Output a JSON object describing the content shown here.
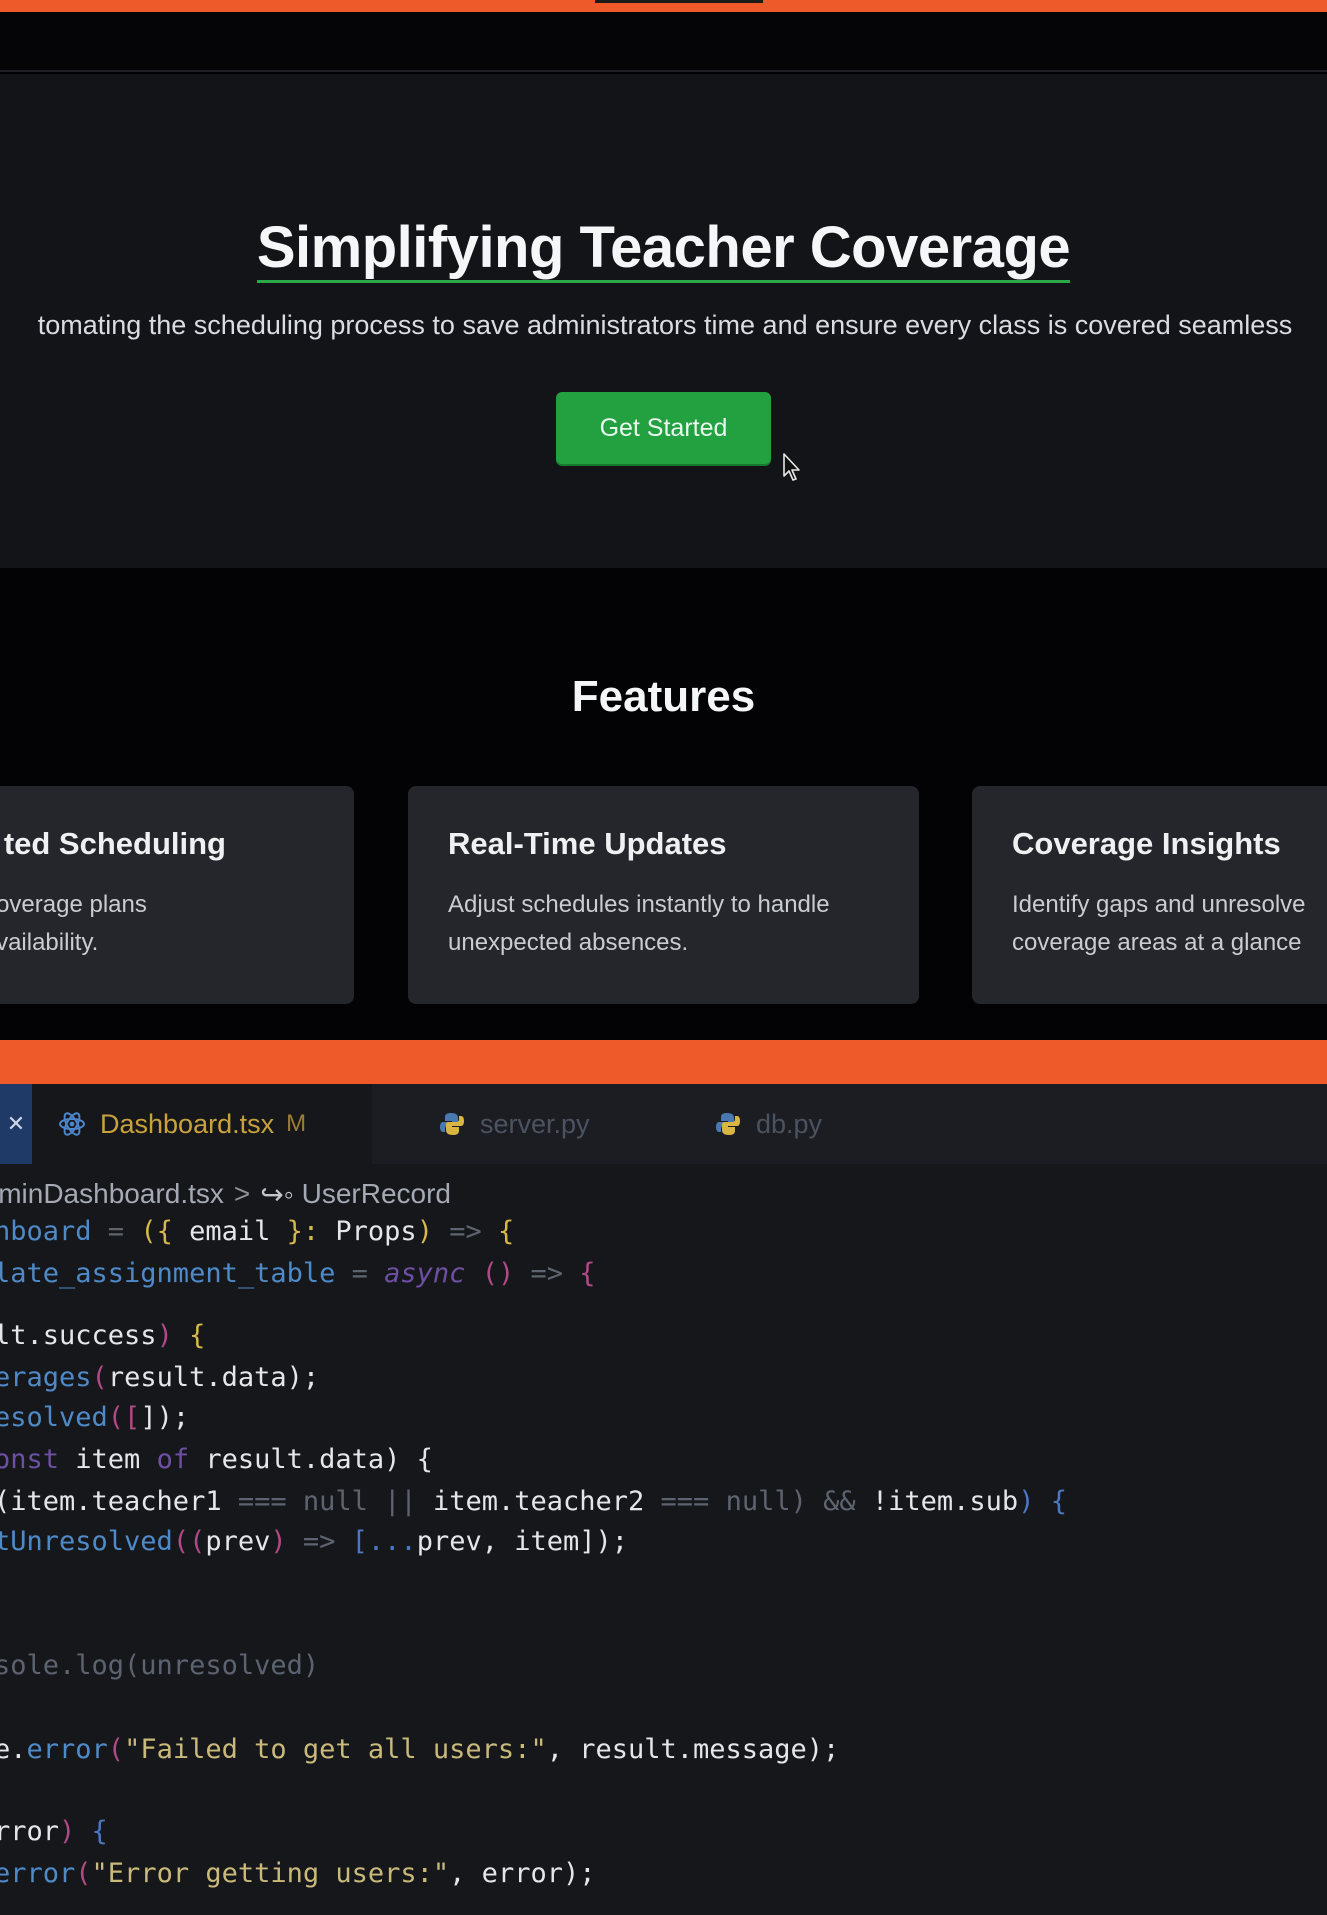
{
  "web": {
    "hero": {
      "title": "Simplifying Teacher Coverage",
      "subtitle": "tomating the scheduling process to save administrators time and ensure every class is covered seamless",
      "cta_label": "Get Started"
    },
    "features": {
      "title": "Features",
      "cards": [
        {
          "title": "ted Scheduling",
          "desc_line1": "enerate coverage plans",
          "desc_line2": "teacher availability."
        },
        {
          "title": "Real-Time Updates",
          "desc_line1": "Adjust schedules instantly to handle",
          "desc_line2": "unexpected absences."
        },
        {
          "title": "Coverage Insights",
          "desc_line1": "Identify gaps and unresolve",
          "desc_line2": "coverage areas at a glance"
        }
      ]
    }
  },
  "editor": {
    "tabs": [
      {
        "label": "Dashboard.tsx",
        "status": "M",
        "icon": "react-icon"
      },
      {
        "label": "server.py",
        "icon": "python-icon"
      },
      {
        "label": "db.py",
        "icon": "python-icon"
      }
    ],
    "close_glyph": "✕",
    "breadcrumb": {
      "file": "lminDashboard.tsx",
      "separator": ">",
      "symbol_icon": "↪◦",
      "symbol": "UserRecord"
    },
    "code_tokens": {
      "l1a": "hboard",
      "l1b": " = ",
      "l1c": "({",
      "l1d": " email ",
      "l1e": "}:",
      "l1f": " Props",
      "l1g": ")",
      "l1h": " => ",
      "l1i": "{",
      "l2a": "late_assignment_table",
      "l2b": " = ",
      "l2c": "async",
      "l2d": " ()",
      "l2e": " => ",
      "l2f": "{",
      "l3a": "lt.success",
      "l3b": ")",
      "l3c": " {",
      "l4a": "erages",
      "l4b": "(",
      "l4c": "result.data",
      "l4d": ");",
      "l5a": "esolved",
      "l5b": "([",
      "l5c": "]);",
      "l6a": "onst",
      "l6b": " item ",
      "l6c": "of",
      "l6d": " result.data",
      "l6e": ") {",
      "l7a": "(item.teacher1 ",
      "l7b": "===",
      "l7c": " null ",
      "l7d": "||",
      "l7e": " item.teacher2 ",
      "l7f": "===",
      "l7g": " null) ",
      "l7h": "&&",
      "l7i": " !item.sub",
      "l7j": ") {",
      "l8a": "tUnresolved",
      "l8b": "((",
      "l8c": "prev",
      "l8d": ")",
      "l8e": " => ",
      "l8f": "[...",
      "l8g": "prev, item",
      "l8h": "]);",
      "l9a": "sole.log(unresolved)",
      "l10a": "e.",
      "l10b": "error",
      "l10c": "(",
      "l10d": "\"Failed to get all users:\"",
      "l10e": ", result.message);",
      "l11a": "rror",
      "l11b": ")",
      "l11c": " {",
      "l12a": "error",
      "l12b": "(",
      "l12c": "\"Error getting users:\"",
      "l12d": ", error);"
    }
  },
  "colors": {
    "accent_orange": "#ef5a2b",
    "cta_green": "#23a040",
    "hero_bg": "#121418",
    "card_bg": "#24262b"
  }
}
